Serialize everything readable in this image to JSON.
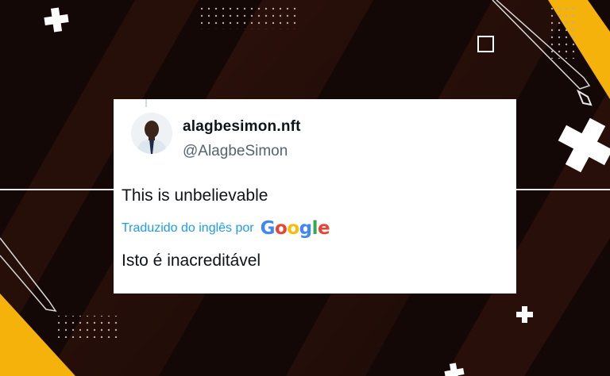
{
  "tweet": {
    "display_name": "alagbesimon.nft",
    "handle": "@AlagbeSimon",
    "text": "This is unbelievable",
    "translated_by": "Traduzido do inglês por",
    "translation_provider": "Google",
    "translated_text": "Isto é inacreditável"
  },
  "colors": {
    "background": "#140807",
    "accent_yellow": "#f5b20b",
    "link_blue": "#1d9bf0"
  }
}
